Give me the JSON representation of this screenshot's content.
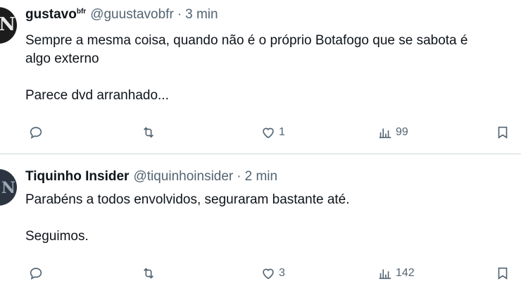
{
  "posts": [
    {
      "author": {
        "name": "gustavo",
        "name_suffix": "bfr",
        "handle": "@guustavobfr",
        "time": "3 min"
      },
      "text": "Sempre a mesma coisa, quando não é o próprio Botafogo que se sabota é\nalgo externo\n\nParece dvd arranhado...",
      "actions": {
        "likes": "1",
        "views": "99"
      }
    },
    {
      "author": {
        "name": "Tiquinho Insider",
        "name_suffix": "",
        "handle": "@tiquinhoinsider",
        "time": "2 min"
      },
      "text": "Parabéns a todos envolvidos, seguraram bastante até.\n\nSeguimos.",
      "actions": {
        "likes": "3",
        "views": "142"
      }
    }
  ],
  "separator": "·",
  "icons": {
    "reply": "reply-icon",
    "repost": "repost-icon",
    "like": "heart-icon",
    "views": "views-bar-chart-icon",
    "bookmark": "bookmark-icon"
  },
  "colors": {
    "text": "#0f1419",
    "secondary": "#536471",
    "divider": "#cfd9de"
  }
}
